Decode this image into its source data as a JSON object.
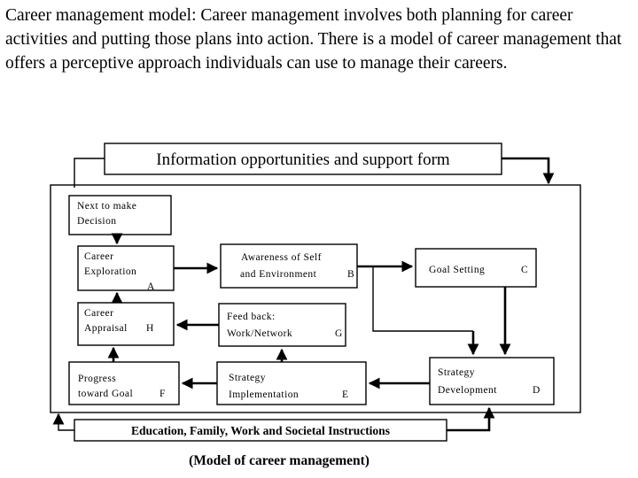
{
  "intro": {
    "paragraph": "Career management model: Career management involves both planning for career activities and putting those plans into action. There is a model of career management that offers a perceptive approach individuals can use to manage their careers."
  },
  "diagram": {
    "header_box": {
      "label": "Information opportunities and support form"
    },
    "footer_bar": {
      "label": "Education, Family, Work and Societal Instructions"
    },
    "caption": "(Model of career management)",
    "nodes": [
      {
        "id": "next",
        "line1": "Next to make",
        "line2": "Decision",
        "tag": ""
      },
      {
        "id": "exploration",
        "line1": "Career",
        "line2": "Exploration",
        "tag": "A"
      },
      {
        "id": "appraisal",
        "line1": "Career",
        "line2": "Appraisal",
        "tag": "H"
      },
      {
        "id": "progress",
        "line1": "Progress",
        "line2": "toward Goal",
        "tag": "F"
      },
      {
        "id": "awareness",
        "line1": "Awareness of Self",
        "line2": "and Environment",
        "tag": "B"
      },
      {
        "id": "feedback",
        "line1": "Feed back:",
        "line2": "Work/Network",
        "tag": "G"
      },
      {
        "id": "strategy_impl",
        "line1": "Strategy",
        "line2": "Implementation",
        "tag": "E"
      },
      {
        "id": "goal_setting",
        "line1": "Goal Setting",
        "line2": "",
        "tag": "C"
      },
      {
        "id": "strategy_dev",
        "line1": "Strategy",
        "line2": "Development",
        "tag": "D"
      }
    ]
  }
}
